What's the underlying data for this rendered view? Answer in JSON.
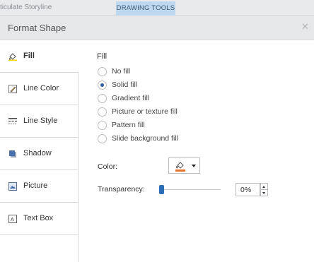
{
  "app": {
    "title_fragment": "ticulate Storyline",
    "context_tab": "DRAWING TOOLS"
  },
  "dialog": {
    "title": "Format Shape",
    "close_icon": "close-icon"
  },
  "sidebar": {
    "items": [
      {
        "label": "Fill",
        "icon": "paint-bucket-icon",
        "active": true
      },
      {
        "label": "Line Color",
        "icon": "pencil-icon",
        "active": false
      },
      {
        "label": "Line Style",
        "icon": "line-style-icon",
        "active": false
      },
      {
        "label": "Shadow",
        "icon": "shadow-icon",
        "active": false
      },
      {
        "label": "Picture",
        "icon": "picture-icon",
        "active": false
      },
      {
        "label": "Text Box",
        "icon": "text-box-icon",
        "active": false
      }
    ]
  },
  "fill": {
    "section_title": "Fill",
    "options": [
      {
        "label": "No fill",
        "selected": false
      },
      {
        "label": "Solid fill",
        "selected": true
      },
      {
        "label": "Gradient fill",
        "selected": false
      },
      {
        "label": "Picture or texture fill",
        "selected": false
      },
      {
        "label": "Pattern fill",
        "selected": false
      },
      {
        "label": "Slide background fill",
        "selected": false
      }
    ],
    "color_label": "Color:",
    "color_value": "#e8742c",
    "transparency_label": "Transparency:",
    "transparency_value": "0%",
    "transparency_fraction": 0
  },
  "colors": {
    "accent": "#2c6db5",
    "context_tab_bg": "#bfd8ee",
    "header_bg": "#e6e7e9"
  }
}
